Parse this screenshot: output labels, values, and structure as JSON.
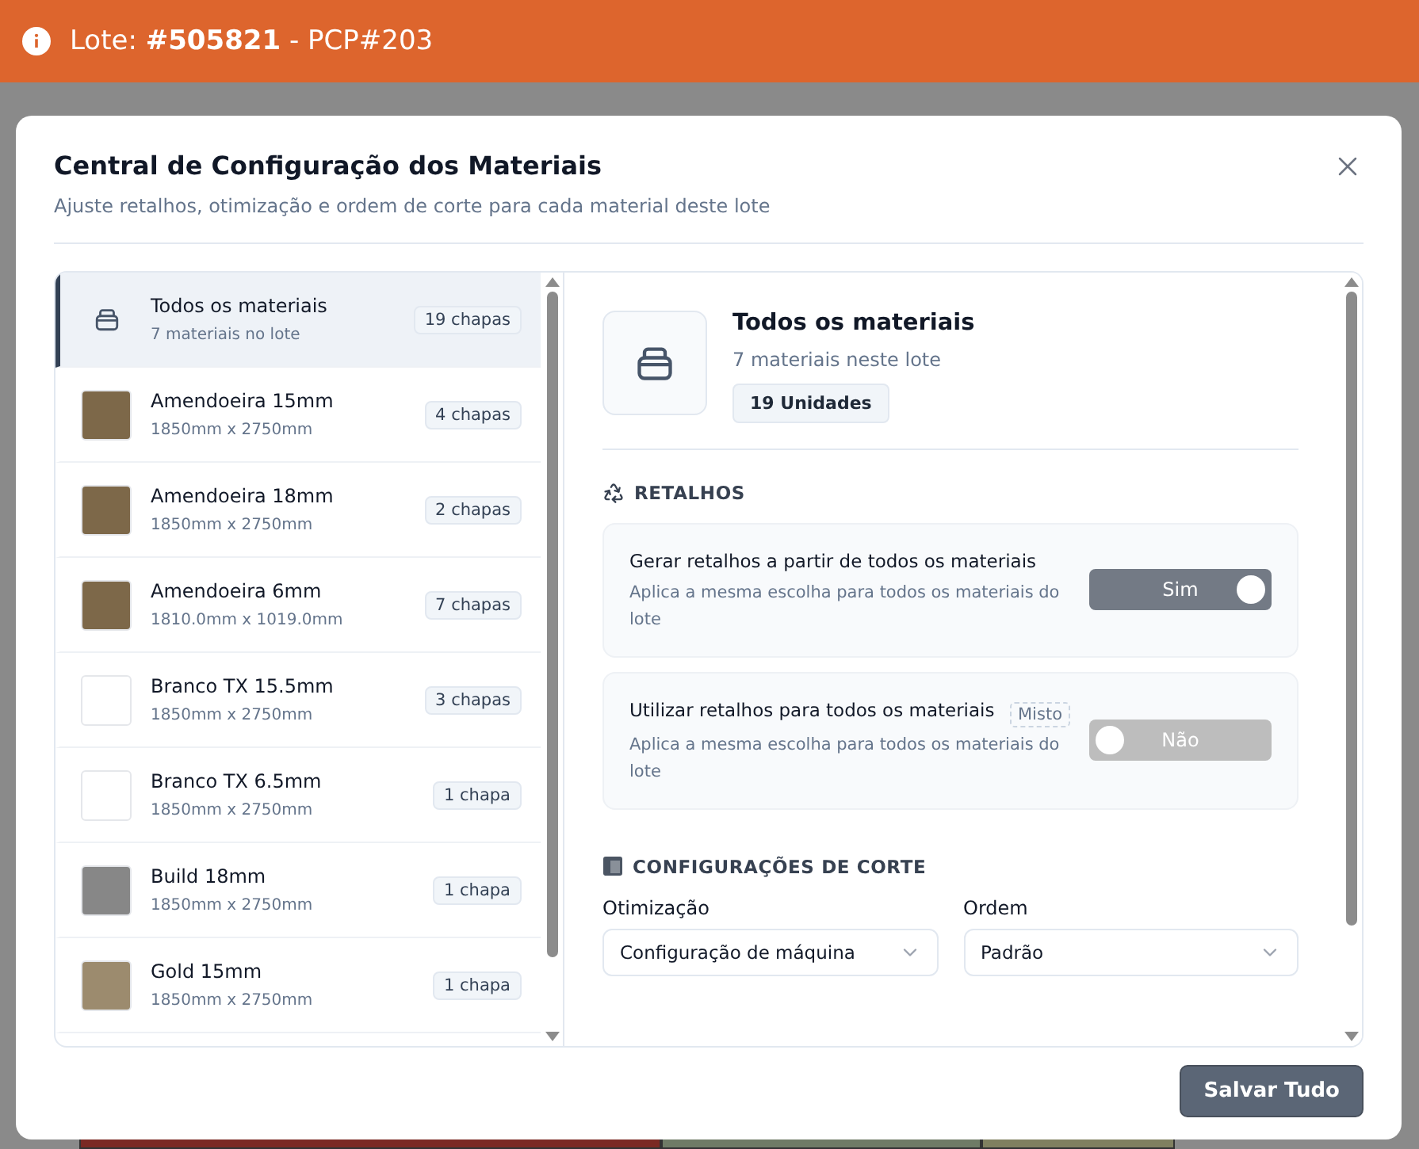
{
  "header": {
    "title": "Lote: **#505821** - PCP#203"
  },
  "dialog": {
    "title": "Central de Configuração dos Materiais",
    "subtitle": "Ajuste retalhos, otimização e ordem de corte para cada material deste lote",
    "materials": [
      {
        "kind": "all",
        "name": "Todos os materiais",
        "detail": "7 materiais no lote",
        "count": "19 chapas",
        "selected": true
      },
      {
        "kind": "material",
        "name": "Amendoeira 15mm",
        "detail": "1850mm x 2750mm",
        "count": "4 chapas",
        "color": "#7d6849",
        "selected": false
      },
      {
        "kind": "material",
        "name": "Amendoeira 18mm",
        "detail": "1850mm x 2750mm",
        "count": "2 chapas",
        "color": "#7d6849",
        "selected": false
      },
      {
        "kind": "material",
        "name": "Amendoeira 6mm",
        "detail": "1810.0mm x 1019.0mm",
        "count": "7 chapas",
        "color": "#7d6849",
        "selected": false
      },
      {
        "kind": "material",
        "name": "Branco TX 15.5mm",
        "detail": "1850mm x 2750mm",
        "count": "3 chapas",
        "color": "#ffffff",
        "selected": false
      },
      {
        "kind": "material",
        "name": "Branco TX 6.5mm",
        "detail": "1850mm x 2750mm",
        "count": "1 chapa",
        "color": "#ffffff",
        "selected": false
      },
      {
        "kind": "material",
        "name": "Build 18mm",
        "detail": "1850mm x 2750mm",
        "count": "1 chapa",
        "color": "#878787",
        "selected": false
      },
      {
        "kind": "material",
        "name": "Gold 15mm",
        "detail": "1850mm x 2750mm",
        "count": "1 chapa",
        "color": "#9c8b6e",
        "selected": false
      }
    ],
    "detail": {
      "title": "Todos os materiais",
      "subtitle": "7 materiais neste lote",
      "units": "19 Unidades",
      "retalhos_heading": "RETALHOS",
      "settings": [
        {
          "label": "Gerar retalhos a partir de todos os materiais",
          "hint": "Aplica a mesma escolha para todos os materiais do lote",
          "toggle_label": "Sim",
          "on": true
        },
        {
          "label": "Utilizar retalhos para todos os materiais",
          "hint": "Aplica a mesma escolha para todos os materiais do lote",
          "badge": "Misto",
          "toggle_label": "Não",
          "on": false
        }
      ],
      "corte_heading": "CONFIGURAÇÕES DE CORTE",
      "selects": [
        {
          "label": "Otimização",
          "value": "Configuração de máquina"
        },
        {
          "label": "Ordem",
          "value": "Padrão"
        }
      ]
    },
    "save_button": "Salvar Tudo"
  }
}
